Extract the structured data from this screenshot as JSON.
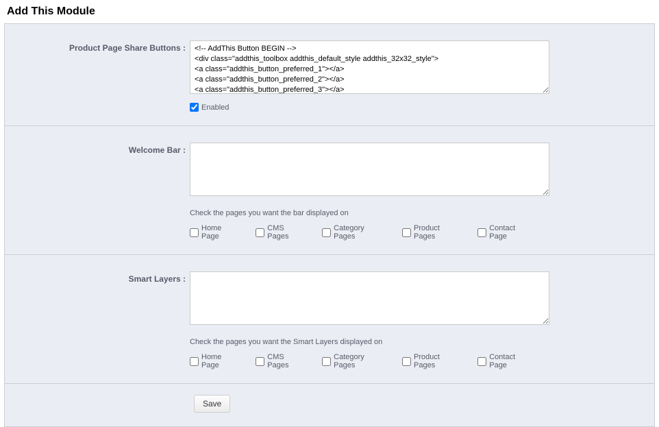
{
  "page_title": "Add This Module",
  "sections": {
    "product_share": {
      "label": "Product Page Share Buttons :",
      "value": "<!-- AddThis Button BEGIN -->\n<div class=\"addthis_toolbox addthis_default_style addthis_32x32_style\">\n<a class=\"addthis_button_preferred_1\"></a>\n<a class=\"addthis_button_preferred_2\"></a>\n<a class=\"addthis_button_preferred_3\"></a>",
      "enabled_label": "Enabled",
      "enabled_checked": true
    },
    "welcome_bar": {
      "label": "Welcome Bar :",
      "value": "",
      "help": "Check the pages you want the bar displayed on",
      "options": [
        {
          "label": "Home Page",
          "checked": false
        },
        {
          "label": "CMS Pages",
          "checked": false
        },
        {
          "label": "Category Pages",
          "checked": false
        },
        {
          "label": "Product Pages",
          "checked": false
        },
        {
          "label": "Contact Page",
          "checked": false
        }
      ]
    },
    "smart_layers": {
      "label": "Smart Layers :",
      "value": "",
      "help": "Check the pages you want the Smart Layers displayed on",
      "options": [
        {
          "label": "Home Page",
          "checked": false
        },
        {
          "label": "CMS Pages",
          "checked": false
        },
        {
          "label": "Category Pages",
          "checked": false
        },
        {
          "label": "Product Pages",
          "checked": false
        },
        {
          "label": "Contact Page",
          "checked": false
        }
      ]
    }
  },
  "save_label": "Save"
}
